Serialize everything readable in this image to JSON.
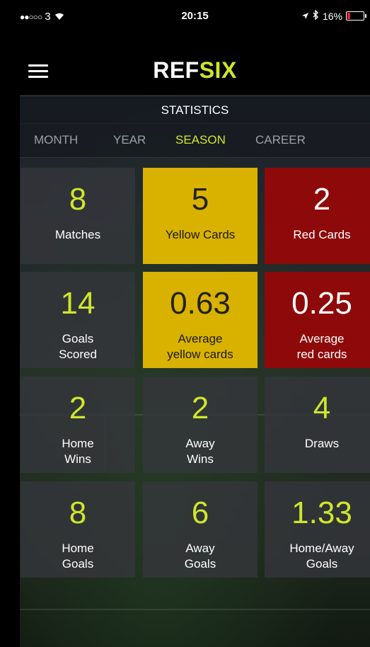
{
  "status_bar": {
    "signal": "●●○○○",
    "carrier": "3",
    "wifi_icon": "wifi-icon",
    "time": "20:15",
    "location_icon": "location-arrow-icon",
    "bluetooth_icon": "bluetooth-icon",
    "battery_percent": "16%",
    "battery_level": 0.16,
    "battery_color": "#e0262e"
  },
  "header": {
    "menu_icon": "hamburger-menu-icon",
    "logo_part1": "REF",
    "logo_part2": "SIX",
    "brand_color": "#cfe62c"
  },
  "section_title": "STATISTICS",
  "tabs": [
    {
      "label": "MONTH",
      "active": false
    },
    {
      "label": "YEAR",
      "active": false
    },
    {
      "label": "SEASON",
      "active": true
    },
    {
      "label": "CAREER",
      "active": false
    }
  ],
  "stats": [
    {
      "value": "8",
      "label_line1": "Matches",
      "label_line2": "",
      "color": "dark"
    },
    {
      "value": "5",
      "label_line1": "Yellow Cards",
      "label_line2": "",
      "color": "yellow"
    },
    {
      "value": "2",
      "label_line1": "Red Cards",
      "label_line2": "",
      "color": "red"
    },
    {
      "value": "14",
      "label_line1": "Goals",
      "label_line2": "Scored",
      "color": "dark"
    },
    {
      "value": "0.63",
      "label_line1": "Average",
      "label_line2": "yellow cards",
      "color": "yellow"
    },
    {
      "value": "0.25",
      "label_line1": "Average",
      "label_line2": "red cards",
      "color": "red"
    },
    {
      "value": "2",
      "label_line1": "Home",
      "label_line2": "Wins",
      "color": "dark"
    },
    {
      "value": "2",
      "label_line1": "Away",
      "label_line2": "Wins",
      "color": "dark"
    },
    {
      "value": "4",
      "label_line1": "Draws",
      "label_line2": "",
      "color": "dark"
    },
    {
      "value": "8",
      "label_line1": "Home",
      "label_line2": "Goals",
      "color": "dark"
    },
    {
      "value": "6",
      "label_line1": "Away",
      "label_line2": "Goals",
      "color": "dark"
    },
    {
      "value": "1.33",
      "label_line1": "Home/Away",
      "label_line2": "Goals",
      "color": "dark"
    }
  ],
  "colors": {
    "accent": "#cfe62c",
    "yellow_tile": "#d9b200",
    "red_tile": "#8e0a0a"
  }
}
